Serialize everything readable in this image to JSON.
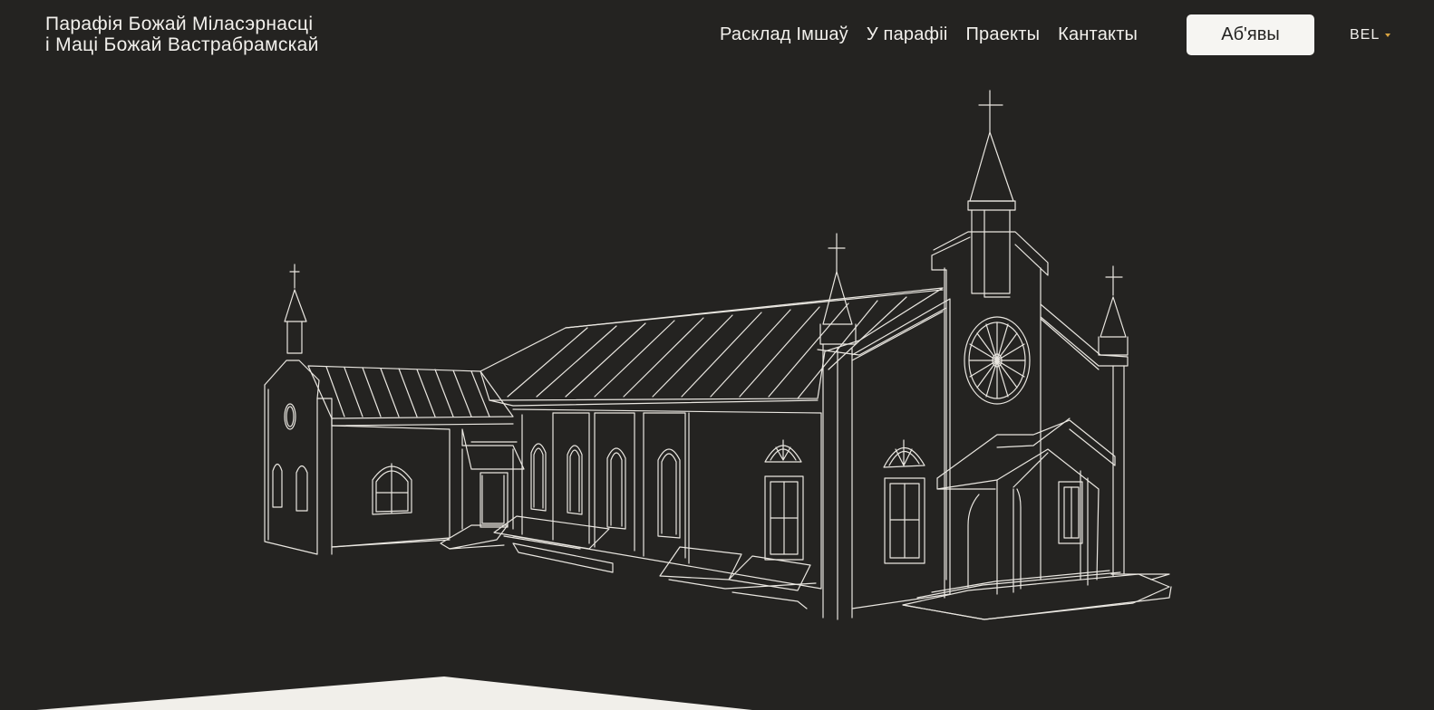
{
  "header": {
    "logo_line1": "Парафія Божай Міласэрнасці",
    "logo_line2": "і Маці Божай Вастрабрамскай",
    "nav": [
      {
        "label": "Расклад Імшаў"
      },
      {
        "label": "У парафіі"
      },
      {
        "label": "Праекты"
      },
      {
        "label": "Кантакты"
      }
    ],
    "announce_button": "Аб'явы",
    "language": "BEL"
  },
  "colors": {
    "background": "#242321",
    "text": "#f2f0ec",
    "button_bg": "#f6f5f2",
    "caret": "#d9a441",
    "drawing_stroke": "#e9e6e0",
    "bottom_panel": "#f1efea"
  },
  "icons": {
    "language_caret": "chevron-down-icon",
    "hero": "church-line-illustration"
  }
}
